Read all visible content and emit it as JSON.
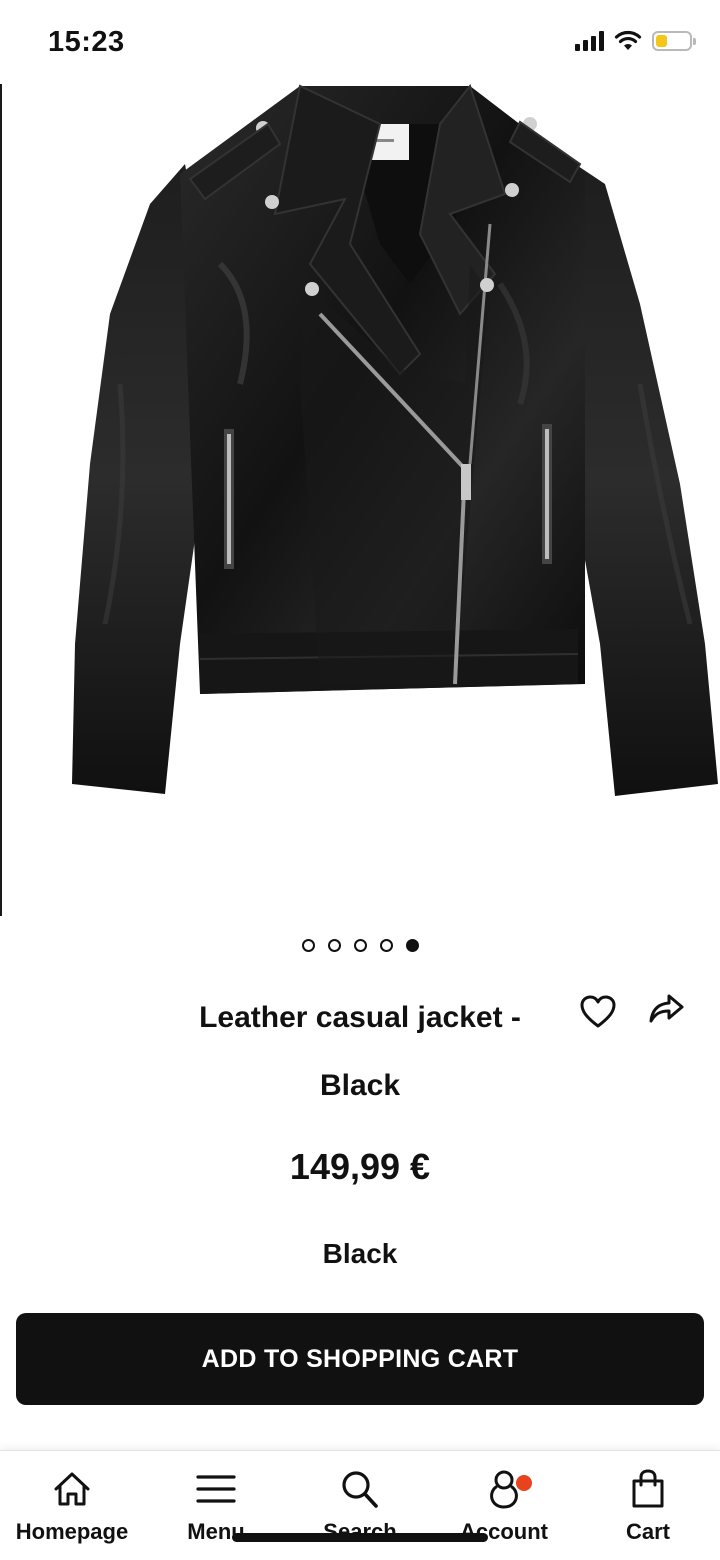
{
  "status_bar": {
    "time": "15:23",
    "icons": [
      "signal-icon",
      "wifi-icon",
      "battery-icon"
    ],
    "battery_color": "#f5c518",
    "battery_level": 0.35
  },
  "product": {
    "image_name": "leather-jacket-image",
    "title": "Leather casual jacket - Black",
    "price": "149,99 €",
    "color": "Black",
    "carousel": {
      "total": 5,
      "active_index": 4
    }
  },
  "actions": {
    "wishlist_icon": "heart-icon",
    "share_icon": "share-icon",
    "add_to_cart_label": "ADD TO SHOPPING CART"
  },
  "bottom_nav": {
    "items": [
      {
        "label": "Homepage",
        "icon": "home-icon"
      },
      {
        "label": "Menu",
        "icon": "menu-icon"
      },
      {
        "label": "Search",
        "icon": "search-icon"
      },
      {
        "label": "Account",
        "icon": "account-icon",
        "has_notification": true
      },
      {
        "label": "Cart",
        "icon": "bag-icon"
      }
    ],
    "notification_color": "#e8421f"
  }
}
